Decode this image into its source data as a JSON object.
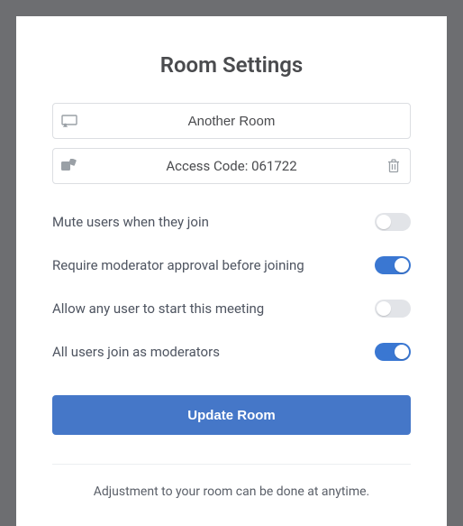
{
  "title": "Room Settings",
  "room_name": "Another Room",
  "access_code_label": "Access Code: 061722",
  "settings": [
    {
      "label": "Mute users when they join",
      "on": false
    },
    {
      "label": "Require moderator approval before joining",
      "on": true
    },
    {
      "label": "Allow any user to start this meeting",
      "on": false
    },
    {
      "label": "All users join as moderators",
      "on": true
    }
  ],
  "update_button": "Update Room",
  "footer_note": "Adjustment to your room can be done at anytime."
}
